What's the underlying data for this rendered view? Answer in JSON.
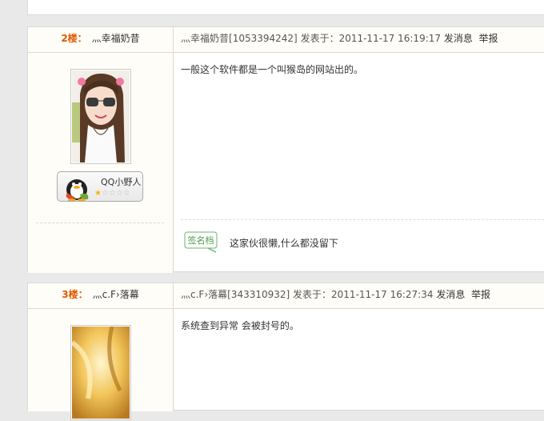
{
  "posts": [
    {
      "floor": "2楼：",
      "username": "灬幸福奶昔",
      "meta_user": "灬幸福奶昔",
      "meta_id": "[1053394242]",
      "meta_posted": "发表于：2011-11-17 16:19:17",
      "send_msg": "发消息",
      "report": "举报",
      "content": "一般这个软件都是一个叫猴岛的网站出的。",
      "qq_name": "QQ小野人",
      "signature_badge": "签名档",
      "signature": "这家伙很懒,什么都没留下"
    },
    {
      "floor": "3楼：",
      "username": "灬c.F›落幕",
      "meta_user": "灬c.F›落幕",
      "meta_id": "[343310932]",
      "meta_posted": "发表于：2011-11-17 16:27:34",
      "send_msg": "发消息",
      "report": "举报",
      "content": "系统查到异常  会被封号的。"
    }
  ],
  "colors": {
    "floor": "#e05a00",
    "border": "#e3d7c7",
    "star_on": "#f5b800"
  },
  "icons": [
    "qq-penguin-icon",
    "star-icon",
    "signature-badge-icon"
  ]
}
